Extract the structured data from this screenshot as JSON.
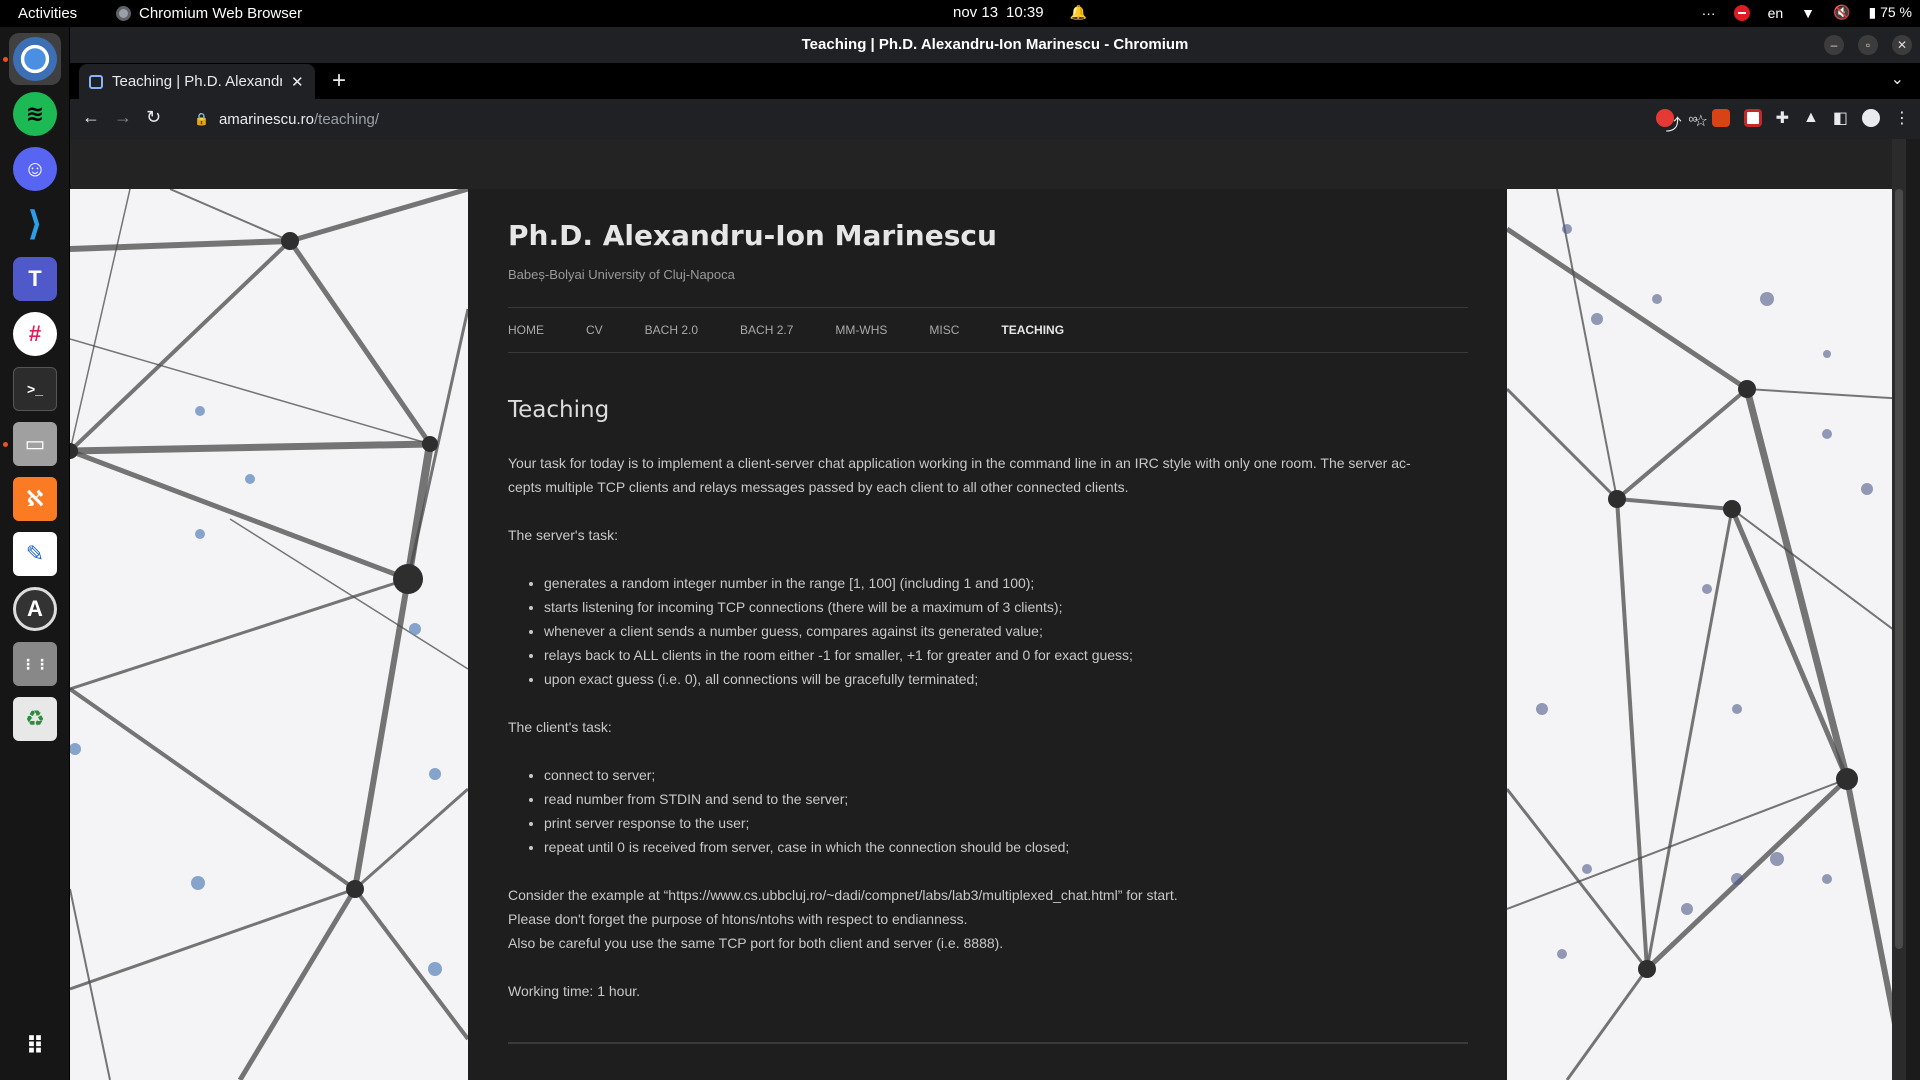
{
  "topbar": {
    "activities": "Activities",
    "app_name": "Chromium Web Browser",
    "date": "nov 13",
    "time": "10:39",
    "lang": "en",
    "battery": "75 %"
  },
  "dock": {
    "apps": [
      "chromium",
      "spotify",
      "discord",
      "vscode",
      "teams",
      "slack",
      "terminal",
      "files",
      "xampp",
      "text-editor",
      "software",
      "apps-drawer-file",
      "trash",
      "show-apps"
    ]
  },
  "window": {
    "title": "Teaching | Ph.D. Alexandru-Ion Marinescu - Chromium",
    "tab_title": "Teaching | Ph.D. Alexandru-Ion Marinescu",
    "url_host": "amarinescu.ro",
    "url_path": "/teaching/"
  },
  "site": {
    "title": "Ph.D. Alexandru-Ion Marinescu",
    "description": "Babeș-Bolyai University of Cluj-Napoca",
    "nav": [
      "HOME",
      "CV",
      "BACH 2.0",
      "BACH 2.7",
      "MM-WHS",
      "MISC",
      "TEACHING"
    ]
  },
  "entry": {
    "title": "Teaching",
    "intro_1": "Your task for today is to implement a client-server chat application working in the command line in an IRC style with only one room. The server ac-",
    "intro_2": "cepts multiple TCP clients and relays messages passed by each client to all other connected clients.",
    "server_heading": "The server's task:",
    "server_tasks": [
      "generates a random integer number in the range [1, 100] (including 1 and 100);",
      "starts listening for incoming TCP connections (there will be a maximum of 3 clients);",
      "whenever a client sends a number guess, compares against its generated value;",
      "relays back to ALL clients in the room either -1 for smaller, +1 for greater and 0 for exact guess;",
      "upon exact guess (i.e. 0), all connections will be gracefully terminated;"
    ],
    "client_heading": "The client's task:",
    "client_tasks": [
      "connect to server;",
      "read number from STDIN and send to the server;",
      "print server response to the user;",
      "repeat until 0 is received from server, case in which the connection should be closed;"
    ],
    "notes": [
      "Consider the example at “https://www.cs.ubbcluj.ro/~dadi/compnet/labs/lab3/multiplexed_chat.html” for start.",
      "Please don't forget the purpose of htons/ntohs with respect to endianness.",
      "Also be careful you use the same TCP port for both client and server (i.e. 8888)."
    ],
    "working_time": "Working time: 1 hour."
  }
}
